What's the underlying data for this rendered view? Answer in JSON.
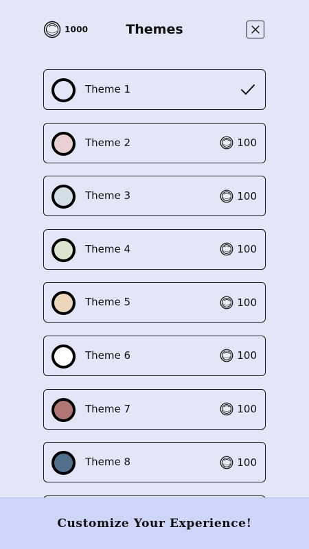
{
  "header": {
    "title": "Themes",
    "coin_balance": "1000"
  },
  "colors": {
    "background": "#e3e6f7",
    "footer_background": "#cdd5f8"
  },
  "themes": [
    {
      "name": "Theme 1",
      "swatch": "#e3e6f7",
      "selected": true,
      "price": ""
    },
    {
      "name": "Theme 2",
      "swatch": "#e8cfd2",
      "selected": false,
      "price": "100"
    },
    {
      "name": "Theme 3",
      "swatch": "#d3dde5",
      "selected": false,
      "price": "100"
    },
    {
      "name": "Theme 4",
      "swatch": "#dde4cf",
      "selected": false,
      "price": "100"
    },
    {
      "name": "Theme 5",
      "swatch": "#ecd6bb",
      "selected": false,
      "price": "100"
    },
    {
      "name": "Theme 6",
      "swatch": "#ffffff",
      "selected": false,
      "price": "100"
    },
    {
      "name": "Theme 7",
      "swatch": "#b07676",
      "selected": false,
      "price": "100"
    },
    {
      "name": "Theme 8",
      "swatch": "#51708c",
      "selected": false,
      "price": "100"
    },
    {
      "name": "",
      "swatch": "#e3e6f7",
      "selected": false,
      "price": ""
    }
  ],
  "footer": {
    "text": "Customize Your Experience!"
  }
}
